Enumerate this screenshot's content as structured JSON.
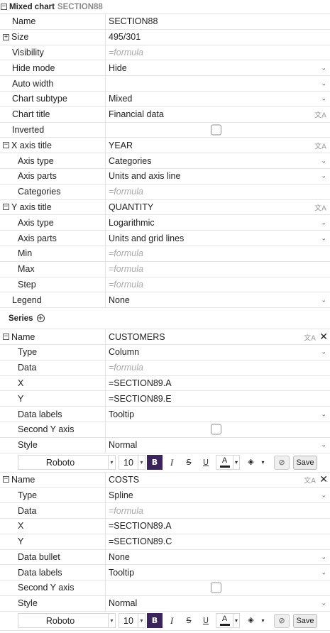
{
  "header": {
    "title": "Mixed chart",
    "section": "SECTION88"
  },
  "main_props": {
    "name": {
      "label": "Name",
      "value": "SECTION88"
    },
    "size": {
      "label": "Size",
      "value": "495/301"
    },
    "visibility": {
      "label": "Visibility",
      "placeholder": "=formula"
    },
    "hide_mode": {
      "label": "Hide mode",
      "value": "Hide"
    },
    "auto_width": {
      "label": "Auto width",
      "value": ""
    },
    "chart_subtype": {
      "label": "Chart subtype",
      "value": "Mixed"
    },
    "chart_title": {
      "label": "Chart title",
      "value": "Financial data"
    },
    "inverted": {
      "label": "Inverted"
    }
  },
  "x_axis": {
    "title_label": "X axis title",
    "title_value": "YEAR",
    "axis_type": {
      "label": "Axis type",
      "value": "Categories"
    },
    "axis_parts": {
      "label": "Axis parts",
      "value": "Units and axis line"
    },
    "categories": {
      "label": "Categories",
      "placeholder": "=formula"
    }
  },
  "y_axis": {
    "title_label": "Y axis title",
    "title_value": "QUANTITY",
    "axis_type": {
      "label": "Axis type",
      "value": "Logarithmic"
    },
    "axis_parts": {
      "label": "Axis parts",
      "value": "Units and grid lines"
    },
    "min": {
      "label": "Min",
      "placeholder": "=formula"
    },
    "max": {
      "label": "Max",
      "placeholder": "=formula"
    },
    "step": {
      "label": "Step",
      "placeholder": "=formula"
    }
  },
  "legend": {
    "label": "Legend",
    "value": "None"
  },
  "series_header": "Series",
  "series": [
    {
      "name_label": "Name",
      "name_value": "CUSTOMERS",
      "type": {
        "label": "Type",
        "value": "Column"
      },
      "data": {
        "label": "Data",
        "placeholder": "=formula"
      },
      "x": {
        "label": "X",
        "value": "=SECTION89.A"
      },
      "y": {
        "label": "Y",
        "value": "=SECTION89.E"
      },
      "data_labels": {
        "label": "Data labels",
        "value": "Tooltip"
      },
      "second_y": {
        "label": "Second Y axis"
      },
      "style": {
        "label": "Style",
        "value": "Normal"
      }
    },
    {
      "name_label": "Name",
      "name_value": "COSTS",
      "type": {
        "label": "Type",
        "value": "Spline"
      },
      "data": {
        "label": "Data",
        "placeholder": "=formula"
      },
      "x": {
        "label": "X",
        "value": "=SECTION89.A"
      },
      "y": {
        "label": "Y",
        "value": "=SECTION89.C"
      },
      "data_bullet": {
        "label": "Data bullet",
        "value": "None"
      },
      "data_labels": {
        "label": "Data labels",
        "value": "Tooltip"
      },
      "second_y": {
        "label": "Second Y axis"
      },
      "style": {
        "label": "Style",
        "value": "Normal"
      }
    }
  ],
  "toolbar": {
    "font": "Roboto",
    "size": "10",
    "bold": "B",
    "italic": "I",
    "strike": "S",
    "underline": "U",
    "text_color_glyph": "A",
    "fill_glyph": "◈",
    "nofmt_glyph": "⊘",
    "save_label": "Save"
  },
  "glyphs": {
    "minus": "−",
    "plus": "+",
    "chevron": "⌄",
    "translate": "文A",
    "close": "✕",
    "add": "+"
  }
}
